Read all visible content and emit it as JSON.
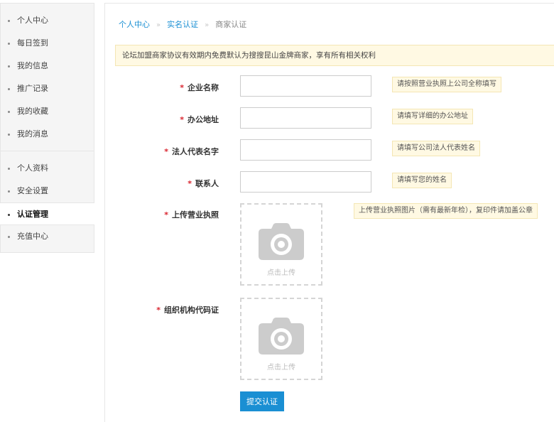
{
  "sidebar": {
    "groups": [
      {
        "items": [
          {
            "label": "个人中心"
          },
          {
            "label": "每日签到"
          },
          {
            "label": "我的信息"
          },
          {
            "label": "推广记录"
          },
          {
            "label": "我的收藏"
          },
          {
            "label": "我的消息"
          }
        ]
      },
      {
        "items": [
          {
            "label": "个人资料"
          },
          {
            "label": "安全设置"
          },
          {
            "label": "认证管理"
          },
          {
            "label": "充值中心"
          }
        ]
      }
    ],
    "active_item": "认证管理"
  },
  "breadcrumb": {
    "items": [
      "个人中心",
      "实名认证",
      "商家认证"
    ],
    "separator": "»"
  },
  "notice": {
    "text": "论坛加盟商家协议有效期内免费默认为搜搜昆山金牌商家，享有所有相关权利"
  },
  "form": {
    "required_mark": "*",
    "company_name": {
      "label": "企业名称",
      "value": "",
      "hint": "请按照营业执照上公司全称填写"
    },
    "office_address": {
      "label": "办公地址",
      "value": "",
      "hint": "请填写详细的办公地址"
    },
    "legal_rep": {
      "label": "法人代表名字",
      "value": "",
      "hint": "请填写公司法人代表姓名"
    },
    "contact": {
      "label": "联系人",
      "value": "",
      "hint": "请填写您的姓名"
    },
    "business_license": {
      "label": "上传营业执照",
      "hint": "上传营业执照图片（需有最新年检），复印件请加盖公章",
      "upload_caption": "点击上传",
      "icon": "camera-icon"
    },
    "org_code": {
      "label": "组织机构代码证",
      "upload_caption": "点击上传",
      "icon": "camera-icon"
    },
    "submit_label": "提交认证"
  },
  "colors": {
    "accent": "#1a8fd3",
    "required": "#d9232d",
    "notice_bg": "#fff9e3",
    "notice_border": "#f4e6b4",
    "sidebar_bg": "#f5f5f5"
  }
}
